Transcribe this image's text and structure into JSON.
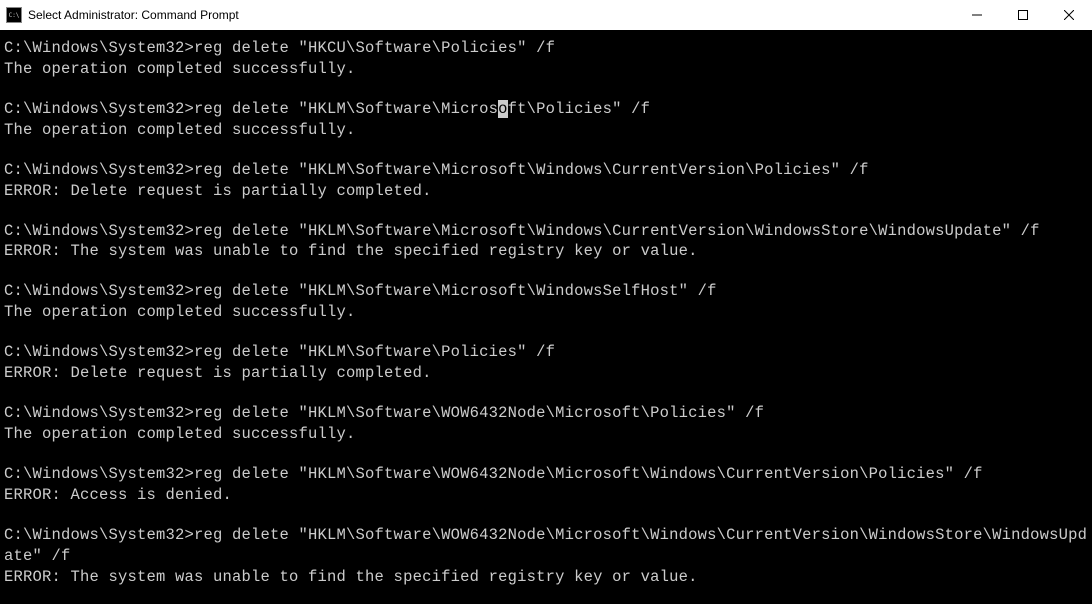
{
  "window": {
    "title": "Select Administrator: Command Prompt"
  },
  "terminal": {
    "prompt": "C:\\Windows\\System32>",
    "entries": [
      {
        "command": "reg delete \"HKCU\\Software\\Policies\" /f",
        "result": "The operation completed successfully.",
        "highlight": false
      },
      {
        "command": "reg delete \"HKLM\\Software\\Microsoft\\Policies\" /f",
        "result": "The operation completed successfully.",
        "highlight": true,
        "highlight_prefix": "reg delete \"HKLM\\Software\\Micros",
        "highlight_char": "o",
        "highlight_suffix": "ft\\Policies\" /f"
      },
      {
        "command": "reg delete \"HKLM\\Software\\Microsoft\\Windows\\CurrentVersion\\Policies\" /f",
        "result": "ERROR: Delete request is partially completed.",
        "highlight": false
      },
      {
        "command": "reg delete \"HKLM\\Software\\Microsoft\\Windows\\CurrentVersion\\WindowsStore\\WindowsUpdate\" /f",
        "result": "ERROR: The system was unable to find the specified registry key or value.",
        "highlight": false
      },
      {
        "command": "reg delete \"HKLM\\Software\\Microsoft\\WindowsSelfHost\" /f",
        "result": "The operation completed successfully.",
        "highlight": false
      },
      {
        "command": "reg delete \"HKLM\\Software\\Policies\" /f",
        "result": "ERROR: Delete request is partially completed.",
        "highlight": false
      },
      {
        "command": "reg delete \"HKLM\\Software\\WOW6432Node\\Microsoft\\Policies\" /f",
        "result": "The operation completed successfully.",
        "highlight": false
      },
      {
        "command": "reg delete \"HKLM\\Software\\WOW6432Node\\Microsoft\\Windows\\CurrentVersion\\Policies\" /f",
        "result": "ERROR: Access is denied.",
        "highlight": false
      },
      {
        "command": "reg delete \"HKLM\\Software\\WOW6432Node\\Microsoft\\Windows\\CurrentVersion\\WindowsStore\\WindowsUpdate\" /f",
        "result": "ERROR: The system was unable to find the specified registry key or value.",
        "highlight": false
      }
    ]
  }
}
